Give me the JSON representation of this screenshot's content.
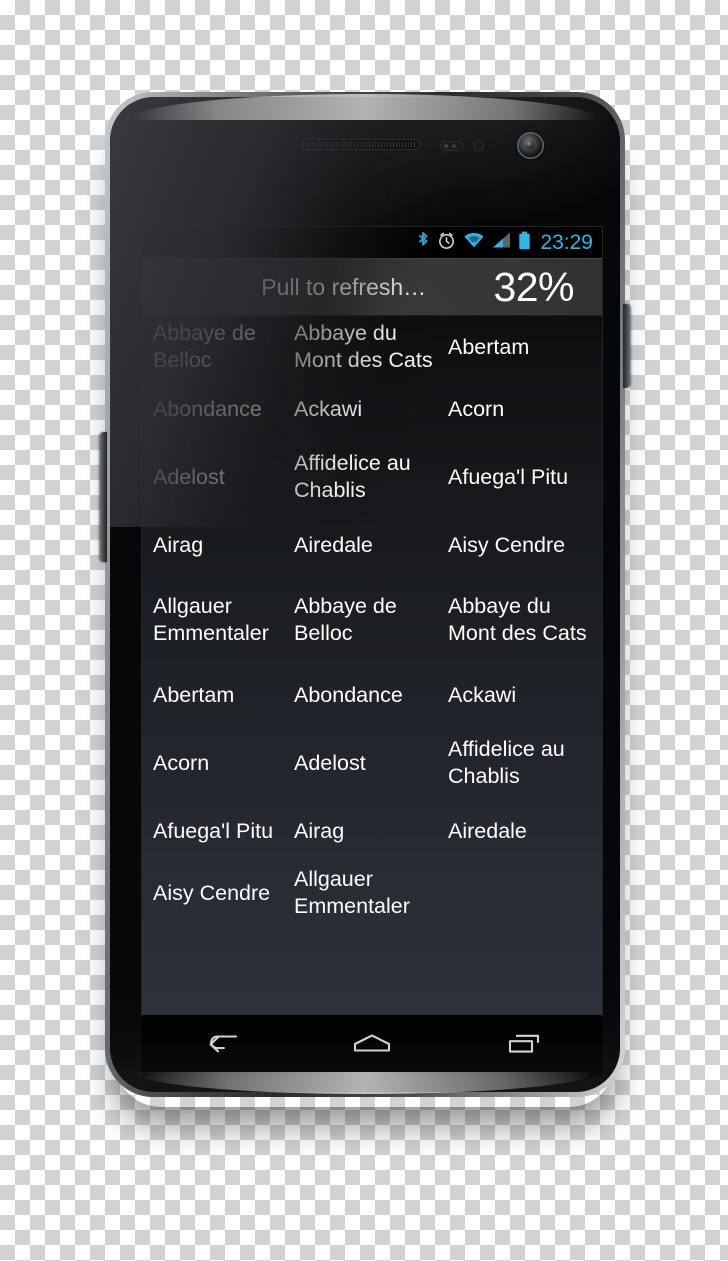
{
  "device": {
    "label": "android-smartphone",
    "hardware": {
      "earpiece": "earpiece-speaker",
      "proximity_sensor": "proximity-sensor",
      "light_sensor": "light-sensor",
      "front_camera": "front-camera",
      "volume_button": "volume-rocker-button",
      "power_button": "power-button"
    }
  },
  "statusbar": {
    "time": "23:29",
    "icons": [
      {
        "name": "bluetooth-icon",
        "color": "#33b5e5"
      },
      {
        "name": "alarm-clock-icon",
        "color": "#e8e8e8"
      },
      {
        "name": "wifi-icon",
        "color": "#33b5e5"
      },
      {
        "name": "cellular-signal-icon",
        "color": "#9aa0a6"
      },
      {
        "name": "battery-icon",
        "color": "#33b5e5"
      }
    ],
    "clock_color": "#33b5e5",
    "background": "#000000"
  },
  "pull_to_refresh": {
    "label": "Pull to refresh…",
    "percent": "32%",
    "background": "#313234"
  },
  "list": {
    "columns": 3,
    "rows": [
      [
        "Abbaye de Belloc",
        "Abbaye du Mont des Cats",
        "Abertam"
      ],
      [
        "Abondance",
        "Ackawi",
        "Acorn"
      ],
      [
        "Adelost",
        "Affidelice au Chablis",
        "Afuega'l Pitu"
      ],
      [
        "Airag",
        "Airedale",
        "Aisy Cendre"
      ],
      [
        "Allgauer Emmentaler",
        "Abbaye de Belloc",
        "Abbaye du Mont des Cats"
      ],
      [
        "Abertam",
        "Abondance",
        "Ackawi"
      ],
      [
        "Acorn",
        "Adelost",
        "Affidelice au Chablis"
      ],
      [
        "Afuega'l Pitu",
        "Airag",
        "Airedale"
      ],
      [
        "Aisy Cendre",
        "Allgauer Emmentaler",
        ""
      ]
    ],
    "text_color": "#ffffff",
    "background_top": "#0d0e10",
    "background_bottom": "#2d313a"
  },
  "navbar": {
    "buttons": [
      {
        "name": "back-button",
        "icon": "back-arrow-icon"
      },
      {
        "name": "home-button",
        "icon": "home-icon"
      },
      {
        "name": "recents-button",
        "icon": "recent-apps-icon"
      }
    ],
    "background": "#000000",
    "icon_color": "#cfd1d3"
  }
}
